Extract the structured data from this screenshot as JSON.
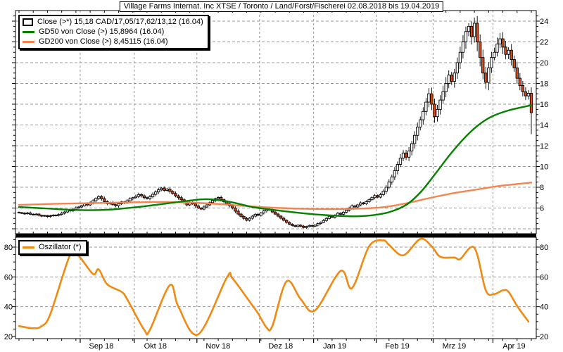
{
  "title": "Village Farms Internat. Inc XTSE / Toronto / Land/Forst/Fischerei 02.08.2018 bis 19.04.2019",
  "colors": {
    "background": "#ffffff",
    "frame": "#000000",
    "grid": "#999999",
    "candle_up_fill": "#ffffff",
    "candle_down_fill": "#e3480f",
    "candle_border": "#000000",
    "gd50": "#068000",
    "gd200": "#f5854f",
    "oscillator": "#f08a12",
    "text": "#000000"
  },
  "chart_data": {
    "type": "candlestick+line",
    "title": "Village Farms Internat. Inc XTSE / Toronto / Land/Forst/Fischerei 02.08.2018 bis 19.04.2019",
    "period": "02.08.2018 bis 19.04.2019",
    "legend": [
      {
        "swatch": "candle",
        "label": "Close (>*) 15,18 CAD/17,05/17,62/13,12 (16.04)"
      },
      {
        "swatch": "line-green",
        "label": "GD50 von Close (>) 15,8964 (16.04)"
      },
      {
        "swatch": "line-orange",
        "label": "GD200 von Close (>) 8,45115 (16.04)"
      }
    ],
    "oscillator_legend": "Oszillator (*)",
    "price_axis_ticks": [
      24,
      22,
      20,
      18,
      16,
      14,
      12,
      10,
      8,
      6
    ],
    "price_axis_range": [
      3.5,
      25.0
    ],
    "oscillator_axis_ticks": [
      80,
      60,
      40,
      20
    ],
    "oscillator_axis_range": [
      18.5,
      86.5
    ],
    "x_labels": [
      "Sep 18",
      "Okt 18",
      "Nov 18",
      "Dez 18",
      "Jan 19",
      "Feb 19",
      "Mrz 19",
      "Apr 19"
    ],
    "month_start_index": [
      22,
      41,
      63,
      85,
      104,
      126,
      146,
      167
    ],
    "last_candle": {
      "open": 17.05,
      "high": 17.62,
      "low": 13.12,
      "close": 15.18,
      "date": "16.04"
    },
    "closes": [
      5.55,
      5.5,
      5.45,
      5.52,
      5.4,
      5.35,
      5.42,
      5.3,
      5.22,
      5.28,
      5.18,
      5.25,
      5.32,
      5.28,
      5.38,
      5.5,
      5.62,
      5.8,
      5.72,
      5.88,
      6.02,
      6.1,
      6.22,
      6.4,
      6.3,
      6.52,
      6.7,
      6.92,
      7.1,
      6.9,
      6.62,
      6.42,
      6.52,
      6.32,
      6.22,
      6.42,
      6.6,
      6.5,
      6.7,
      6.88,
      7.0,
      7.12,
      7.3,
      7.18,
      7.0,
      6.92,
      7.1,
      7.32,
      7.55,
      7.75,
      7.92,
      7.7,
      7.82,
      7.6,
      7.4,
      7.18,
      7.0,
      6.8,
      6.52,
      6.3,
      6.5,
      6.4,
      6.2,
      6.0,
      5.9,
      6.1,
      6.3,
      6.52,
      6.72,
      6.9,
      7.02,
      6.8,
      6.6,
      6.4,
      6.2,
      6.0,
      5.7,
      5.42,
      5.2,
      5.0,
      4.82,
      5.02,
      5.22,
      5.4,
      5.3,
      5.52,
      5.72,
      5.9,
      5.8,
      5.62,
      5.42,
      5.22,
      5.02,
      4.82,
      4.62,
      4.45,
      4.32,
      4.22,
      4.35,
      4.25,
      4.12,
      4.22,
      4.32,
      4.25,
      4.35,
      4.5,
      4.62,
      4.8,
      5.0,
      5.2,
      5.1,
      5.3,
      5.5,
      5.4,
      5.6,
      5.8,
      6.0,
      6.2,
      6.1,
      6.3,
      6.5,
      6.4,
      6.62,
      6.8,
      7.0,
      7.2,
      7.05,
      7.3,
      7.62,
      8.0,
      8.5,
      9.0,
      9.6,
      10.2,
      10.8,
      11.3,
      10.9,
      11.5,
      12.2,
      13.0,
      13.8,
      14.5,
      15.3,
      16.2,
      17.0,
      16.0,
      14.8,
      15.5,
      16.4,
      17.2,
      18.0,
      18.8,
      18.2,
      19.0,
      20.0,
      21.0,
      22.0,
      23.0,
      23.5,
      22.5,
      23.8,
      22.0,
      20.5,
      19.0,
      18.1,
      19.5,
      20.5,
      21.0,
      21.8,
      22.3,
      21.5,
      20.8,
      21.2,
      20.3,
      19.5,
      18.5,
      17.8,
      17.2,
      16.8,
      17.05,
      15.18
    ],
    "overrides": {
      "100": {
        "low": 4.05
      },
      "160": {
        "high": 24.35
      },
      "180": {
        "open": 17.05,
        "high": 17.62,
        "low": 13.12,
        "close": 15.18
      }
    },
    "first_open": 5.6,
    "gd50_points": [
      [
        0,
        6.1
      ],
      [
        10,
        5.95
      ],
      [
        22,
        5.8
      ],
      [
        32,
        5.85
      ],
      [
        45,
        6.2
      ],
      [
        58,
        6.65
      ],
      [
        66,
        6.85
      ],
      [
        74,
        6.6
      ],
      [
        82,
        6.1
      ],
      [
        90,
        5.8
      ],
      [
        98,
        5.55
      ],
      [
        106,
        5.35
      ],
      [
        112,
        5.25
      ],
      [
        118,
        5.2
      ],
      [
        124,
        5.3
      ],
      [
        130,
        5.6
      ],
      [
        136,
        6.3
      ],
      [
        141,
        7.5
      ],
      [
        146,
        9.2
      ],
      [
        151,
        11.0
      ],
      [
        156,
        12.6
      ],
      [
        161,
        13.9
      ],
      [
        166,
        14.8
      ],
      [
        172,
        15.4
      ],
      [
        180,
        15.9
      ]
    ],
    "gd200_points": [
      [
        0,
        6.3
      ],
      [
        15,
        6.42
      ],
      [
        35,
        6.52
      ],
      [
        50,
        6.58
      ],
      [
        62,
        6.5
      ],
      [
        72,
        6.35
      ],
      [
        82,
        6.15
      ],
      [
        92,
        6.0
      ],
      [
        102,
        5.92
      ],
      [
        112,
        5.9
      ],
      [
        120,
        5.95
      ],
      [
        128,
        6.08
      ],
      [
        136,
        6.45
      ],
      [
        144,
        6.95
      ],
      [
        152,
        7.4
      ],
      [
        160,
        7.75
      ],
      [
        168,
        8.1
      ],
      [
        174,
        8.28
      ],
      [
        180,
        8.45
      ]
    ],
    "oscillator_points": [
      [
        0,
        27
      ],
      [
        5,
        25.5
      ],
      [
        8,
        27
      ],
      [
        11,
        35
      ],
      [
        18,
        75
      ],
      [
        21,
        74
      ],
      [
        26,
        62
      ],
      [
        28,
        65
      ],
      [
        31,
        55
      ],
      [
        36,
        50
      ],
      [
        38,
        45
      ],
      [
        44,
        24.5
      ],
      [
        46,
        24.5
      ],
      [
        53,
        54.5
      ],
      [
        56,
        40
      ],
      [
        63,
        21.5
      ],
      [
        73,
        59.5
      ],
      [
        75,
        59
      ],
      [
        81,
        43.5
      ],
      [
        84,
        35.5
      ],
      [
        87,
        26
      ],
      [
        89,
        27
      ],
      [
        94,
        57
      ],
      [
        99,
        45
      ],
      [
        104,
        37.5
      ],
      [
        113,
        64
      ],
      [
        117,
        52.5
      ],
      [
        123,
        80.5
      ],
      [
        128,
        84.5
      ],
      [
        130,
        81.5
      ],
      [
        135,
        74.5
      ],
      [
        141,
        85.5
      ],
      [
        145,
        80.5
      ],
      [
        148,
        73.5
      ],
      [
        153,
        73
      ],
      [
        155,
        72
      ],
      [
        160,
        79.5
      ],
      [
        164,
        51
      ],
      [
        167,
        48.5
      ],
      [
        170,
        51
      ],
      [
        172,
        50
      ],
      [
        175,
        40.5
      ],
      [
        179,
        30
      ]
    ]
  }
}
